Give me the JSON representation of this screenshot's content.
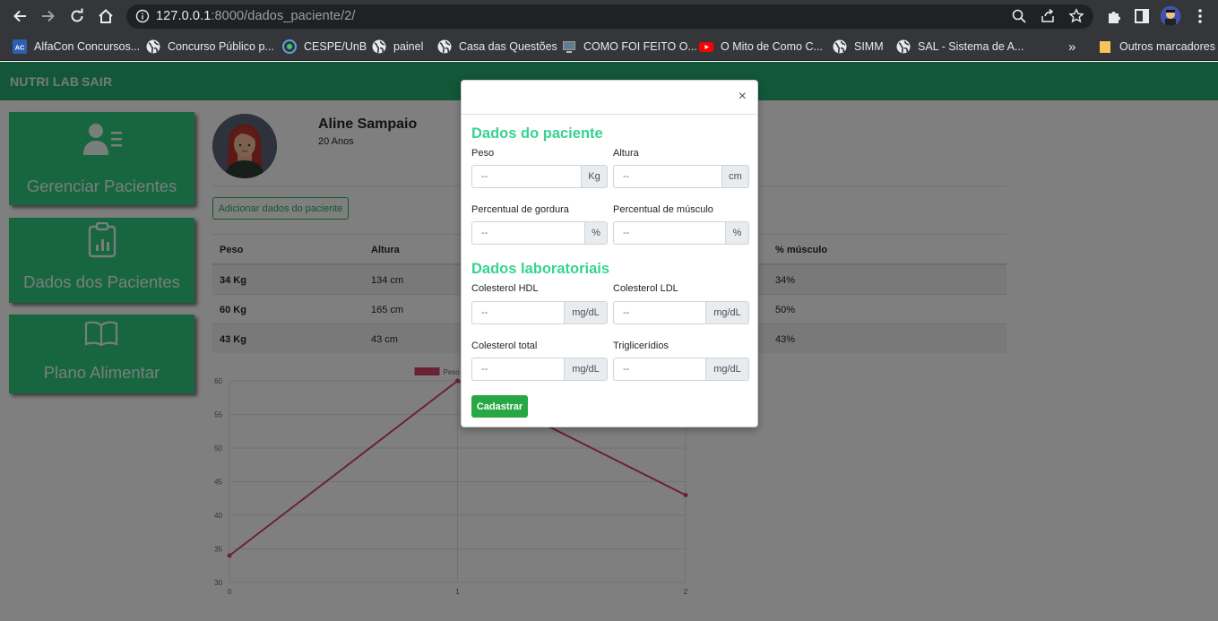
{
  "browser": {
    "url_host": "127.0.0.1",
    "url_rest": ":8000/dados_paciente/2/",
    "bookmarks": [
      {
        "label": "AlfaCon Concursos..."
      },
      {
        "label": "Concurso Público p..."
      },
      {
        "label": "CESPE/UnB"
      },
      {
        "label": "painel"
      },
      {
        "label": "Casa das Questões"
      },
      {
        "label": "COMO FOI FEITO O..."
      },
      {
        "label": "O Mito de Como C..."
      },
      {
        "label": "SIMM"
      },
      {
        "label": "SAL - Sistema de A..."
      }
    ],
    "bookmarks_overflow": "»",
    "other_bookmarks": "Outros marcadores"
  },
  "app": {
    "brand": "NUTRI LAB",
    "logout": "SAIR",
    "sidebar": [
      {
        "label": "Gerenciar Pacientes"
      },
      {
        "label": "Dados dos Pacientes"
      },
      {
        "label": "Plano Alimentar"
      }
    ]
  },
  "patient": {
    "name": "Aline Sampaio",
    "age": "20 Anos",
    "add_data_button": "Adicionar dados do paciente"
  },
  "table": {
    "headers": [
      "Peso",
      "Altura",
      "% músculo"
    ],
    "rows": [
      {
        "peso": "34 Kg",
        "altura": "134 cm",
        "musculo": "34%"
      },
      {
        "peso": "60 Kg",
        "altura": "165 cm",
        "musculo": "50%"
      },
      {
        "peso": "43 Kg",
        "altura": "43 cm",
        "musculo": "43%"
      }
    ]
  },
  "chart_data": {
    "type": "line",
    "x": [
      0,
      1,
      2
    ],
    "series": [
      {
        "name": "Peso",
        "values": [
          34,
          60,
          43
        ],
        "color": "#d6456a"
      }
    ],
    "ylim": [
      30,
      60
    ],
    "yticks": [
      30,
      35,
      40,
      45,
      50,
      55,
      60
    ],
    "xticks": [
      0,
      1,
      2
    ],
    "grid": true,
    "legend": "top-center"
  },
  "modal": {
    "close": "×",
    "section1_title": "Dados do paciente",
    "section2_title": "Dados laboratoriais",
    "placeholder": "--",
    "fields": {
      "peso": {
        "label": "Peso",
        "unit": "Kg"
      },
      "altura": {
        "label": "Altura",
        "unit": "cm"
      },
      "gordura": {
        "label": "Percentual de gordura",
        "unit": "%"
      },
      "musculo": {
        "label": "Percentual de músculo",
        "unit": "%"
      },
      "hdl": {
        "label": "Colesterol HDL",
        "unit": "mg/dL"
      },
      "ldl": {
        "label": "Colesterol LDL",
        "unit": "mg/dL"
      },
      "total": {
        "label": "Colesterol total",
        "unit": "mg/dL"
      },
      "trig": {
        "label": "Triglicerídios",
        "unit": "mg/dL"
      }
    },
    "submit": "Cadastrar"
  },
  "colors": {
    "nav_green": "#27ae73",
    "card_green": "#2ecc80",
    "title_green": "#36d392",
    "button_green": "#28a745",
    "line_series": "#d6456a"
  }
}
